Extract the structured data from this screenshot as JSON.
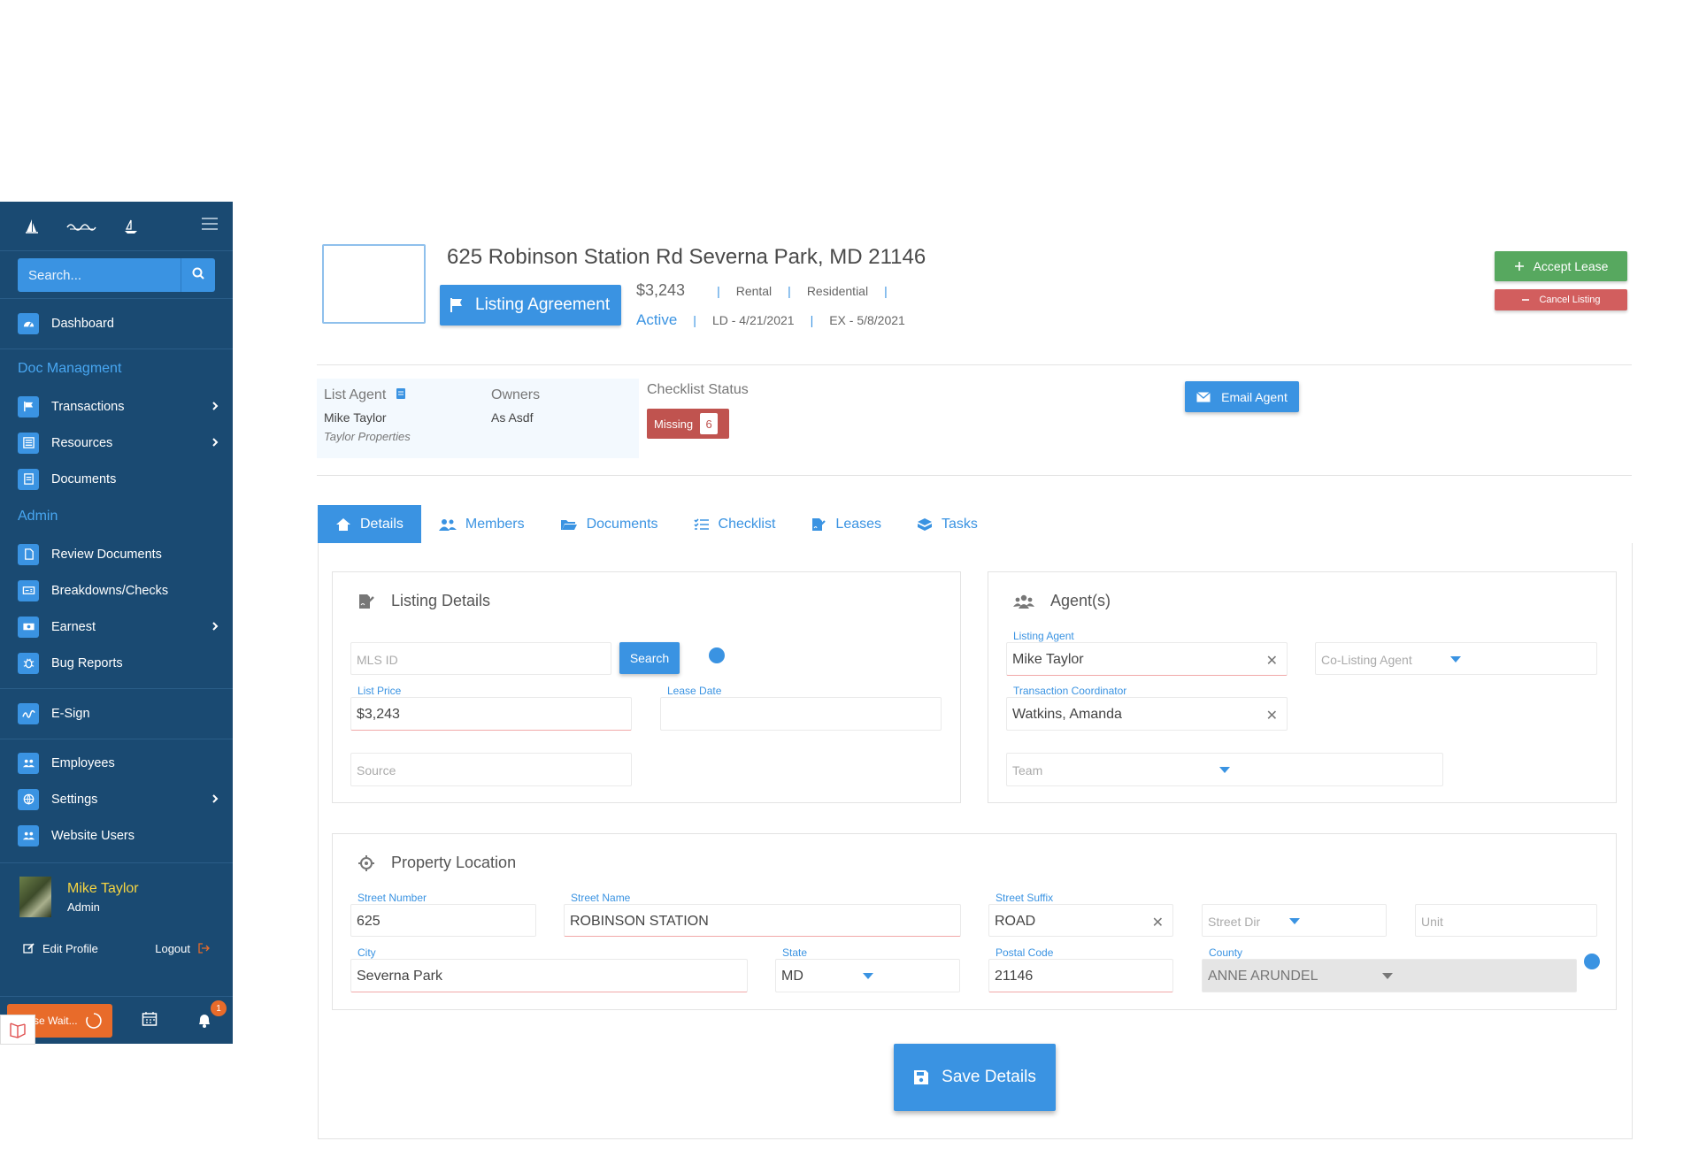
{
  "sidebar": {
    "search_placeholder": "Search...",
    "items": {
      "dashboard": "Dashboard",
      "doc_section": "Doc Managment",
      "transactions": "Transactions",
      "resources": "Resources",
      "documents": "Documents",
      "admin_section": "Admin",
      "review_documents": "Review Documents",
      "breakdowns": "Breakdowns/Checks",
      "earnest": "Earnest",
      "bug_reports": "Bug Reports",
      "esign": "E-Sign",
      "employees": "Employees",
      "settings": "Settings",
      "website_users": "Website Users"
    },
    "profile": {
      "name": "Mike Taylor",
      "role": "Admin",
      "edit_label": "Edit Profile",
      "logout_label": "Logout"
    },
    "bottom": {
      "wait_label": "se Wait...",
      "notification_count": "1"
    }
  },
  "header": {
    "address": "625 Robinson Station Rd Severna Park, MD 21146",
    "listing_agreement_label": "Listing Agreement",
    "price": "$3,243",
    "type": "Rental",
    "category": "Residential",
    "status": "Active",
    "list_date": "LD - 4/21/2021",
    "expire_date": "EX - 5/8/2021",
    "accept_label": "Accept Lease",
    "cancel_label": "Cancel Listing"
  },
  "agent_strip": {
    "list_agent_label": "List Agent",
    "list_agent_name": "Mike Taylor",
    "list_agent_company": "Taylor Properties",
    "owners_label": "Owners",
    "owners_value": "As Asdf",
    "checklist_label": "Checklist Status",
    "missing_label": "Missing",
    "missing_count": "6",
    "email_agent_label": "Email Agent"
  },
  "tabs": [
    "Details",
    "Members",
    "Documents",
    "Checklist",
    "Leases",
    "Tasks"
  ],
  "listing_details": {
    "title": "Listing Details",
    "mls_placeholder": "MLS ID",
    "search_label": "Search",
    "list_price_label": "List Price",
    "list_price_value": "$3,243",
    "lease_date_label": "Lease Date",
    "source_placeholder": "Source"
  },
  "agents": {
    "title": "Agent(s)",
    "listing_agent_label": "Listing Agent",
    "listing_agent_value": "Mike Taylor",
    "co_listing_placeholder": "Co-Listing Agent",
    "tc_label": "Transaction Coordinator",
    "tc_value": "Watkins, Amanda",
    "team_placeholder": "Team"
  },
  "property_location": {
    "title": "Property Location",
    "street_number_label": "Street Number",
    "street_number_value": "625",
    "street_name_label": "Street Name",
    "street_name_value": "ROBINSON STATION",
    "street_suffix_label": "Street Suffix",
    "street_suffix_value": "ROAD",
    "street_dir_placeholder": "Street Dir",
    "unit_placeholder": "Unit",
    "city_label": "City",
    "city_value": "Severna Park",
    "state_label": "State",
    "state_value": "MD",
    "postal_label": "Postal Code",
    "postal_value": "21146",
    "county_label": "County",
    "county_value": "ANNE ARUNDEL"
  },
  "save_label": "Save Details"
}
